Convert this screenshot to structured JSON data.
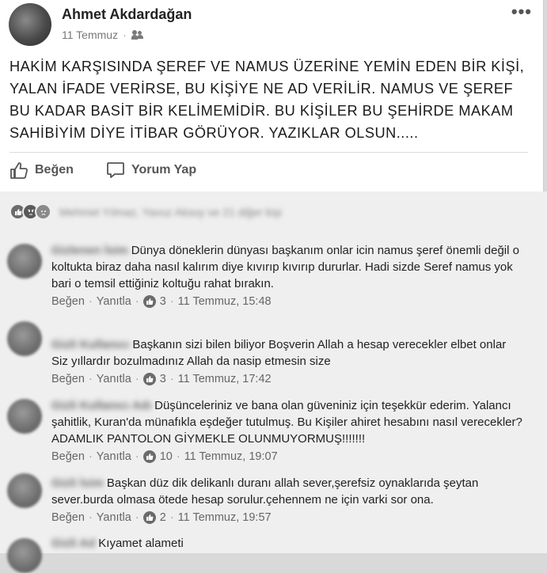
{
  "post": {
    "author": "Ahmet Akdardağan",
    "date": "11 Temmuz",
    "dot": "·",
    "more": "•••",
    "text": "HAKİM KARŞISINDA ŞEREF VE NAMUS ÜZERİNE YEMİN EDEN BİR KİŞİ, YALAN İFADE VERİRSE, BU KİŞİYE NE AD VERİLİR. NAMUS VE ŞEREF BU KADAR BASİT BİR KELİMEMİDİR. BU KİŞİLER BU ŞEHİRDE MAKAM SAHİBİYİM DİYE İTİBAR GÖRÜYOR. YAZIKLAR OLSUN.....",
    "like_label": "Beğen",
    "comment_label": "Yorum Yap"
  },
  "reactions": {
    "summary": "Mehmet Yılmaz, Yavuz Aksoy ve 21 diğer kişi",
    "icons": [
      "like-icon",
      "angry-icon",
      "sad-icon"
    ]
  },
  "comments": [
    {
      "name": "Gizlenen İsim",
      "text": "Dünya döneklerin dünyası başkanım onlar icin namus şeref önemli değil o koltukta biraz daha nasıl kalırım diye kıvırıp kıvırıp dururlar. Hadi sizde Seref namus yok bari o temsil ettiğiniz koltuğu rahat bırakın.",
      "like": "Beğen",
      "reply": "Yanıtla",
      "likes": "3",
      "time": "11 Temmuz, 15:48"
    },
    {
      "name": "Gizli Kullanıcı",
      "text": "Başkanın sizi bilen biliyor Boşverin Allah a hesap verecekler elbet onlar\nSiz yıllardır bozulmadınız Allah da nasip etmesin size",
      "like": "Beğen",
      "reply": "Yanıtla",
      "likes": "3",
      "time": "11 Temmuz, 17:42"
    },
    {
      "name": "Gizli Kullanıcı Adı",
      "text": "Düşünceleriniz ve bana olan güveniniz için teşekkür ederim. Yalancı şahitlik, Kuran'da münafıkla eşdeğer tutulmuş. Bu Kişiler ahiret hesabını nasıl verecekler? ADAMLIK PANTOLON GİYMEKLE OLUNMUYORMUŞ!!!!!!!",
      "like": "Beğen",
      "reply": "Yanıtla",
      "likes": "10",
      "time": "11 Temmuz, 19:07"
    },
    {
      "name": "Gizli İsim",
      "text": "Başkan düz dik delikanlı duranı allah sever,şerefsiz oynaklarıda şeytan sever.burda olmasa ötede hesap sorulur.çehennem ne için varki sor ona.",
      "like": "Beğen",
      "reply": "Yanıtla",
      "likes": "2",
      "time": "11 Temmuz, 19:57"
    },
    {
      "name": "Gizli Ad",
      "text": "Kıyamet alameti"
    }
  ]
}
